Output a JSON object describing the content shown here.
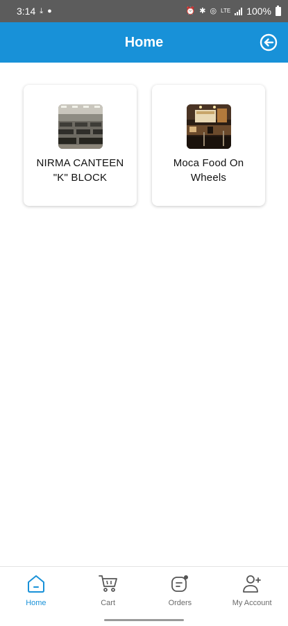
{
  "status_bar": {
    "time": "3:14",
    "battery": "100%"
  },
  "app_bar": {
    "title": "Home",
    "logout_icon": "logout-arrow-icon"
  },
  "canteens": [
    {
      "name": "NIRMA CANTEEN \"K\" BLOCK",
      "image": "canteen-hall-photo"
    },
    {
      "name": "Moca Food On Wheels",
      "image": "food-counter-photo"
    }
  ],
  "bottom_nav": {
    "items": [
      {
        "label": "Home",
        "icon": "home-icon",
        "active": true
      },
      {
        "label": "Cart",
        "icon": "cart-icon",
        "active": false
      },
      {
        "label": "Orders",
        "icon": "orders-icon",
        "active": false
      },
      {
        "label": "My Account",
        "icon": "user-add-icon",
        "active": false
      }
    ]
  },
  "colors": {
    "primary": "#1891d8",
    "status_bar": "#5c5c5c",
    "inactive": "#6a6a6a"
  }
}
